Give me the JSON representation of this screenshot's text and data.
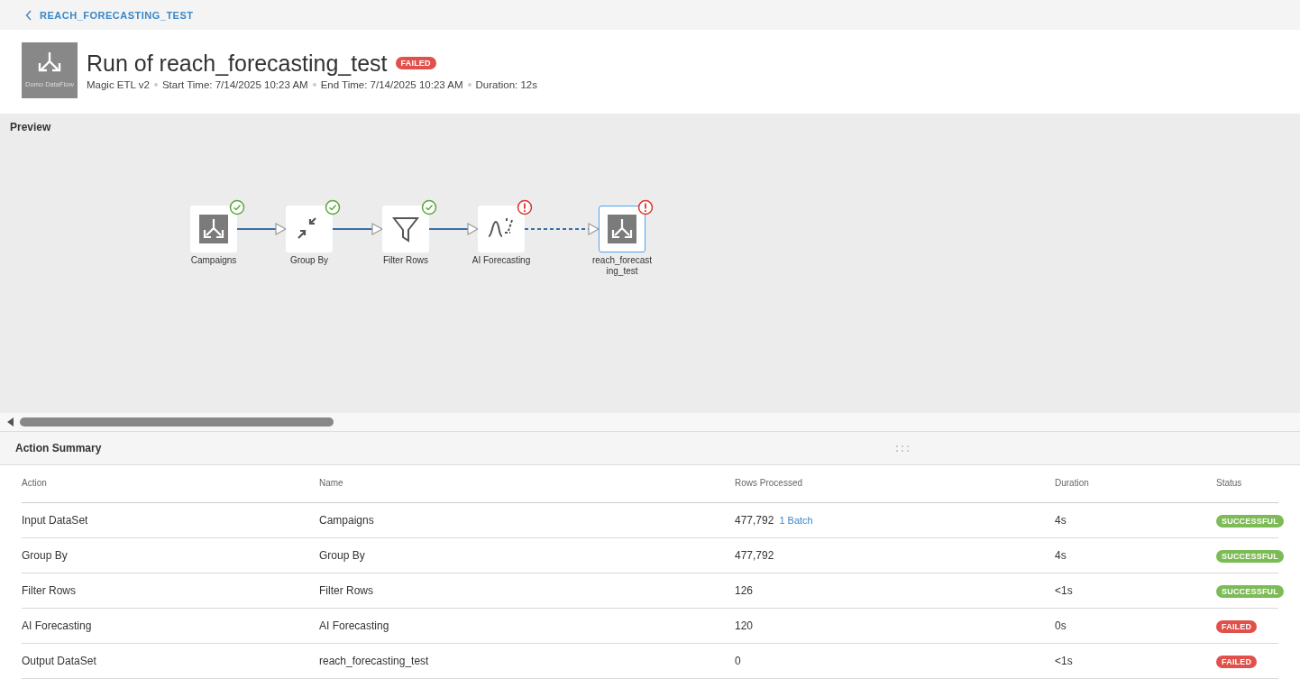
{
  "breadcrumb": {
    "label": "REACH_FORECASTING_TEST"
  },
  "header": {
    "logo_caption": "Domo DataFlow",
    "title": "Run of reach_forecasting_test",
    "status": {
      "label": "FAILED",
      "kind": "failed"
    },
    "meta": [
      "Magic ETL v2",
      "Start Time: 7/14/2025 10:23 AM",
      "End Time: 7/14/2025 10:23 AM",
      "Duration: 12s"
    ]
  },
  "preview": {
    "title": "Preview",
    "nodes": [
      {
        "label": "Campaigns",
        "kind": "dataset",
        "failed": false,
        "selected": false
      },
      {
        "label": "Group By",
        "kind": "group",
        "failed": false,
        "selected": false
      },
      {
        "label": "Filter Rows",
        "kind": "filter",
        "failed": false,
        "selected": false
      },
      {
        "label": "AI Forecasting",
        "kind": "forecast",
        "failed": true,
        "selected": false
      },
      {
        "label": "reach_forecasting_test",
        "kind": "dataset",
        "failed": true,
        "selected": true
      }
    ]
  },
  "action_summary": {
    "title": "Action Summary",
    "columns": [
      "Action",
      "Name",
      "Rows Processed",
      "Duration",
      "Status"
    ],
    "rows": [
      {
        "action": "Input DataSet",
        "name": "Campaigns",
        "rows": "477,792",
        "batch": "1 Batch",
        "duration": "4s",
        "status": {
          "label": "SUCCESSFUL",
          "kind": "success"
        }
      },
      {
        "action": "Group By",
        "name": "Group By",
        "rows": "477,792",
        "duration": "4s",
        "status": {
          "label": "SUCCESSFUL",
          "kind": "success"
        }
      },
      {
        "action": "Filter Rows",
        "name": "Filter Rows",
        "rows": "126",
        "duration": "<1s",
        "status": {
          "label": "SUCCESSFUL",
          "kind": "success"
        }
      },
      {
        "action": "AI Forecasting",
        "name": "AI Forecasting",
        "rows": "120",
        "duration": "0s",
        "status": {
          "label": "FAILED",
          "kind": "failed"
        }
      },
      {
        "action": "Output DataSet",
        "name": "reach_forecasting_test",
        "rows": "0",
        "duration": "<1s",
        "status": {
          "label": "FAILED",
          "kind": "failed"
        }
      }
    ]
  }
}
